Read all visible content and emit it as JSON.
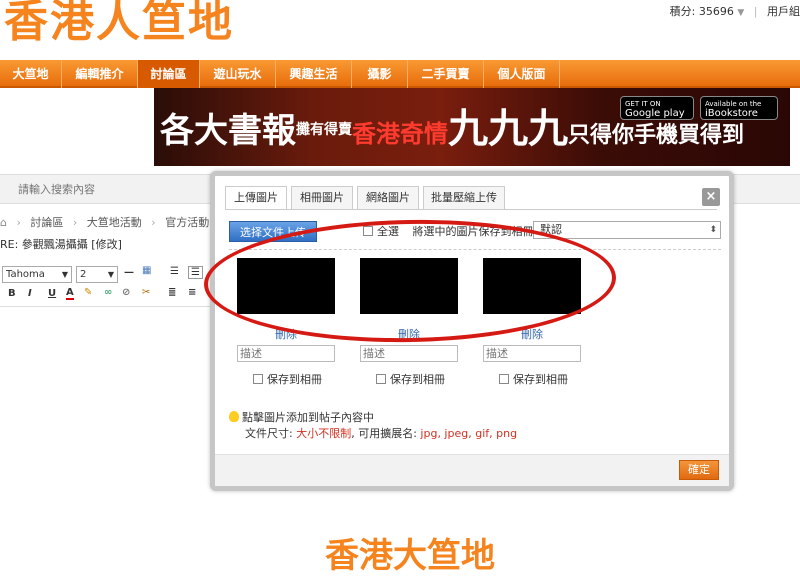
{
  "header": {
    "logo": "香港人笪地",
    "points_label": "積分: 35696",
    "user_text": "用戶組"
  },
  "nav": [
    "大笪地",
    "編輯推介",
    "討論區",
    "遊山玩水",
    "興趣生活",
    "攝影",
    "二手買賣",
    "個人版面"
  ],
  "banner": {
    "text_a": "各大書報",
    "text_b": "攤有得賣",
    "text_c": "香港奇情",
    "text_d": "九九九",
    "text_e": "只得你手機買得到",
    "google_play_small": "GET IT ON",
    "google_play": "Google play",
    "appstore_small": "Available on the",
    "appstore": "iBookstore"
  },
  "search": {
    "placeholder": "請輸入搜索內容"
  },
  "breadcrumb": [
    "討論區",
    "大笪地活動",
    "官方活動"
  ],
  "reply_title": "RE: 參觀飄湯攝攝 [修改]",
  "editor": {
    "font": "Tahoma",
    "size": "2"
  },
  "modal": {
    "tabs": [
      "上傳圖片",
      "相冊圖片",
      "網絡圖片",
      "批量壓縮上传"
    ],
    "upload_button": "选择文件上传",
    "select_all": "全選",
    "move_label": "將選中的圖片保存到相冊:",
    "album_value": "默認",
    "images": [
      {
        "delete_label": "刪除",
        "desc_placeholder": "描述",
        "save_label": "保存到相冊"
      },
      {
        "delete_label": "刪除",
        "desc_placeholder": "描述",
        "save_label": "保存到相冊"
      },
      {
        "delete_label": "刪除",
        "desc_placeholder": "描述",
        "save_label": "保存到相冊"
      }
    ],
    "tip": "點擊圖片添加到帖子內容中",
    "size_prefix": "文件尺寸:",
    "size_value": "大小不限制",
    "ext_prefix": ", 可用擴展名:",
    "ext_value": "jpg, jpeg, gif, png",
    "confirm": "確定"
  },
  "footer_logo": "香港大笪地"
}
